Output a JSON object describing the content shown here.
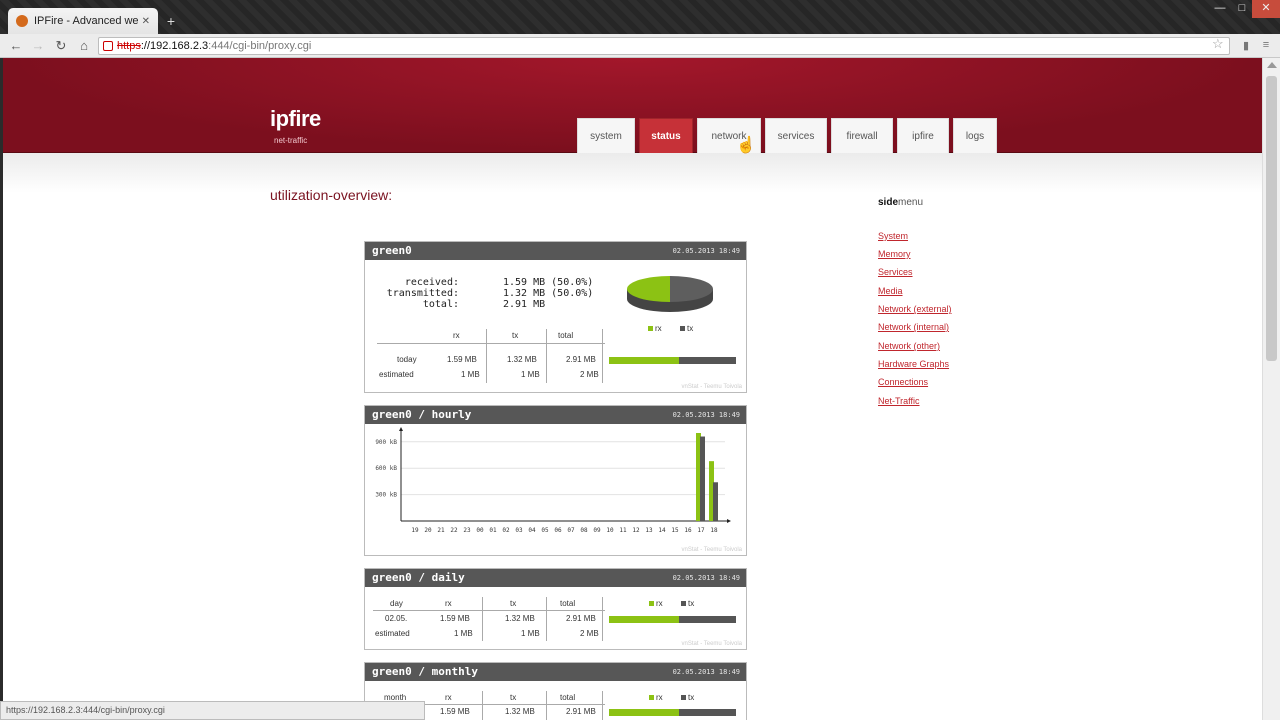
{
  "browser": {
    "tab_title": "IPFire - Advanced web pr",
    "tab_close": "✕",
    "new_tab": "+",
    "url_scheme": "https",
    "url_host": "://192.168.2.3",
    "url_path": ":444/cgi-bin/proxy.cgi",
    "status_url": "https://192.168.2.3:444/cgi-bin/proxy.cgi"
  },
  "site": {
    "logo": "ipfire",
    "subtitle": "net-traffic",
    "nav": [
      "system",
      "status",
      "network",
      "services",
      "firewall",
      "ipfire",
      "logs"
    ],
    "active_nav": "status"
  },
  "page": {
    "title": "utilization-overview:"
  },
  "sidemenu": {
    "title_bold": "side",
    "title_rest": "menu",
    "links": [
      "System",
      "Memory",
      "Services",
      "Media",
      "Network (external)",
      "Network (internal)",
      "Network (other)",
      "Hardware Graphs",
      "Connections",
      "Net-Traffic"
    ]
  },
  "colors": {
    "rx": "#8cc214",
    "tx": "#555555",
    "brand": "#7c0f1e",
    "active_tab": "#c63138"
  },
  "summary": {
    "header": "green0",
    "timestamp": "02.05.2013 18:49",
    "received_label": "received:",
    "received_value": "1.59 MB (50.0%)",
    "transmitted_label": "transmitted:",
    "transmitted_value": "1.32 MB (50.0%)",
    "total_label": "total:",
    "total_value": "2.91 MB",
    "pie": {
      "rx_share": 0.5
    },
    "legend": [
      "rx",
      "tx"
    ],
    "table": {
      "headers": [
        "rx",
        "tx",
        "total"
      ],
      "rows": [
        {
          "label": "today",
          "rx": "1.59 MB",
          "tx": "1.32 MB",
          "total": "2.91 MB",
          "rx_share": 0.55
        },
        {
          "label": "estimated",
          "rx": "1 MB",
          "tx": "1 MB",
          "total": "2 MB"
        }
      ]
    },
    "footer": "vnStat - Teemu Toivola"
  },
  "hourly": {
    "header": "green0 / hourly",
    "timestamp": "02.05.2013 18:49",
    "footer": "vnStat - Teemu Toivola"
  },
  "daily": {
    "header": "green0 / daily",
    "timestamp": "02.05.2013 18:49",
    "headers": [
      "day",
      "rx",
      "tx",
      "total"
    ],
    "legend": [
      "rx",
      "tx"
    ],
    "rows": [
      {
        "label": "02.05.",
        "rx": "1.59 MB",
        "tx": "1.32 MB",
        "total": "2.91 MB",
        "rx_share": 0.55
      },
      {
        "label": "estimated",
        "rx": "1 MB",
        "tx": "1 MB",
        "total": "2 MB"
      }
    ],
    "footer": "vnStat - Teemu Toivola"
  },
  "monthly": {
    "header": "green0 / monthly",
    "timestamp": "02.05.2013 18:49",
    "headers": [
      "month",
      "rx",
      "tx",
      "total"
    ],
    "legend": [
      "rx",
      "tx"
    ],
    "rows": [
      {
        "label": "",
        "rx": "1.59 MB",
        "tx": "1.32 MB",
        "total": "2.91 MB",
        "rx_share": 0.55
      }
    ]
  },
  "chart_data": {
    "type": "bar",
    "x": [
      "19",
      "20",
      "21",
      "22",
      "23",
      "00",
      "01",
      "02",
      "03",
      "04",
      "05",
      "06",
      "07",
      "08",
      "09",
      "10",
      "11",
      "12",
      "13",
      "14",
      "15",
      "16",
      "17",
      "18"
    ],
    "ylabel": "",
    "y_ticks": [
      "300 kB",
      "600 kB",
      "900 kB"
    ],
    "ylim": [
      0,
      1000
    ],
    "series": [
      {
        "name": "rx",
        "values": [
          0,
          0,
          0,
          0,
          0,
          0,
          0,
          0,
          0,
          0,
          0,
          0,
          0,
          0,
          0,
          0,
          0,
          0,
          0,
          0,
          0,
          0,
          1000,
          680
        ]
      },
      {
        "name": "tx",
        "values": [
          0,
          0,
          0,
          0,
          0,
          0,
          0,
          0,
          0,
          0,
          0,
          0,
          0,
          0,
          0,
          0,
          0,
          0,
          0,
          0,
          0,
          0,
          960,
          440
        ]
      }
    ],
    "grid": true
  }
}
